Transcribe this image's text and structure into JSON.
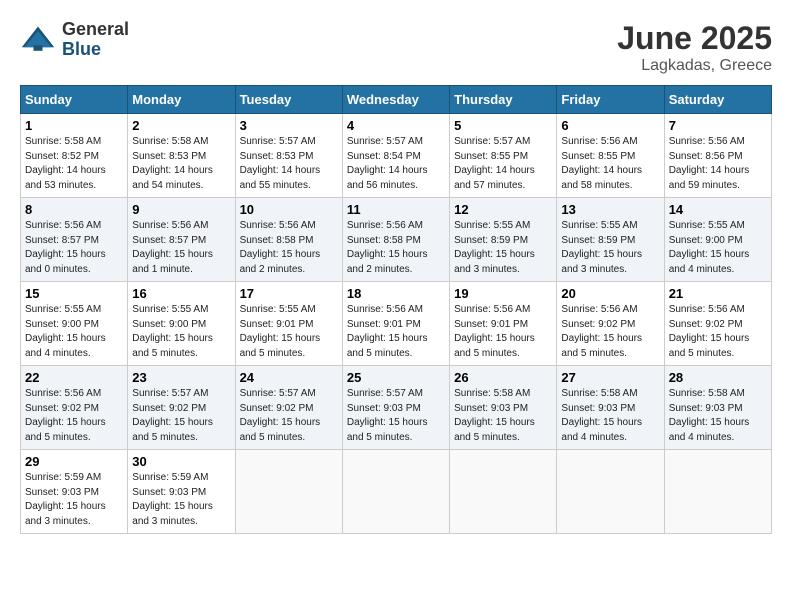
{
  "logo": {
    "general": "General",
    "blue": "Blue"
  },
  "title": {
    "month": "June 2025",
    "location": "Lagkadas, Greece"
  },
  "headers": [
    "Sunday",
    "Monday",
    "Tuesday",
    "Wednesday",
    "Thursday",
    "Friday",
    "Saturday"
  ],
  "weeks": [
    [
      {
        "day": "1",
        "info": "Sunrise: 5:58 AM\nSunset: 8:52 PM\nDaylight: 14 hours\nand 53 minutes."
      },
      {
        "day": "2",
        "info": "Sunrise: 5:58 AM\nSunset: 8:53 PM\nDaylight: 14 hours\nand 54 minutes."
      },
      {
        "day": "3",
        "info": "Sunrise: 5:57 AM\nSunset: 8:53 PM\nDaylight: 14 hours\nand 55 minutes."
      },
      {
        "day": "4",
        "info": "Sunrise: 5:57 AM\nSunset: 8:54 PM\nDaylight: 14 hours\nand 56 minutes."
      },
      {
        "day": "5",
        "info": "Sunrise: 5:57 AM\nSunset: 8:55 PM\nDaylight: 14 hours\nand 57 minutes."
      },
      {
        "day": "6",
        "info": "Sunrise: 5:56 AM\nSunset: 8:55 PM\nDaylight: 14 hours\nand 58 minutes."
      },
      {
        "day": "7",
        "info": "Sunrise: 5:56 AM\nSunset: 8:56 PM\nDaylight: 14 hours\nand 59 minutes."
      }
    ],
    [
      {
        "day": "8",
        "info": "Sunrise: 5:56 AM\nSunset: 8:57 PM\nDaylight: 15 hours\nand 0 minutes."
      },
      {
        "day": "9",
        "info": "Sunrise: 5:56 AM\nSunset: 8:57 PM\nDaylight: 15 hours\nand 1 minute."
      },
      {
        "day": "10",
        "info": "Sunrise: 5:56 AM\nSunset: 8:58 PM\nDaylight: 15 hours\nand 2 minutes."
      },
      {
        "day": "11",
        "info": "Sunrise: 5:56 AM\nSunset: 8:58 PM\nDaylight: 15 hours\nand 2 minutes."
      },
      {
        "day": "12",
        "info": "Sunrise: 5:55 AM\nSunset: 8:59 PM\nDaylight: 15 hours\nand 3 minutes."
      },
      {
        "day": "13",
        "info": "Sunrise: 5:55 AM\nSunset: 8:59 PM\nDaylight: 15 hours\nand 3 minutes."
      },
      {
        "day": "14",
        "info": "Sunrise: 5:55 AM\nSunset: 9:00 PM\nDaylight: 15 hours\nand 4 minutes."
      }
    ],
    [
      {
        "day": "15",
        "info": "Sunrise: 5:55 AM\nSunset: 9:00 PM\nDaylight: 15 hours\nand 4 minutes."
      },
      {
        "day": "16",
        "info": "Sunrise: 5:55 AM\nSunset: 9:00 PM\nDaylight: 15 hours\nand 5 minutes."
      },
      {
        "day": "17",
        "info": "Sunrise: 5:55 AM\nSunset: 9:01 PM\nDaylight: 15 hours\nand 5 minutes."
      },
      {
        "day": "18",
        "info": "Sunrise: 5:56 AM\nSunset: 9:01 PM\nDaylight: 15 hours\nand 5 minutes."
      },
      {
        "day": "19",
        "info": "Sunrise: 5:56 AM\nSunset: 9:01 PM\nDaylight: 15 hours\nand 5 minutes."
      },
      {
        "day": "20",
        "info": "Sunrise: 5:56 AM\nSunset: 9:02 PM\nDaylight: 15 hours\nand 5 minutes."
      },
      {
        "day": "21",
        "info": "Sunrise: 5:56 AM\nSunset: 9:02 PM\nDaylight: 15 hours\nand 5 minutes."
      }
    ],
    [
      {
        "day": "22",
        "info": "Sunrise: 5:56 AM\nSunset: 9:02 PM\nDaylight: 15 hours\nand 5 minutes."
      },
      {
        "day": "23",
        "info": "Sunrise: 5:57 AM\nSunset: 9:02 PM\nDaylight: 15 hours\nand 5 minutes."
      },
      {
        "day": "24",
        "info": "Sunrise: 5:57 AM\nSunset: 9:02 PM\nDaylight: 15 hours\nand 5 minutes."
      },
      {
        "day": "25",
        "info": "Sunrise: 5:57 AM\nSunset: 9:03 PM\nDaylight: 15 hours\nand 5 minutes."
      },
      {
        "day": "26",
        "info": "Sunrise: 5:58 AM\nSunset: 9:03 PM\nDaylight: 15 hours\nand 5 minutes."
      },
      {
        "day": "27",
        "info": "Sunrise: 5:58 AM\nSunset: 9:03 PM\nDaylight: 15 hours\nand 4 minutes."
      },
      {
        "day": "28",
        "info": "Sunrise: 5:58 AM\nSunset: 9:03 PM\nDaylight: 15 hours\nand 4 minutes."
      }
    ],
    [
      {
        "day": "29",
        "info": "Sunrise: 5:59 AM\nSunset: 9:03 PM\nDaylight: 15 hours\nand 3 minutes."
      },
      {
        "day": "30",
        "info": "Sunrise: 5:59 AM\nSunset: 9:03 PM\nDaylight: 15 hours\nand 3 minutes."
      },
      {
        "day": "",
        "info": ""
      },
      {
        "day": "",
        "info": ""
      },
      {
        "day": "",
        "info": ""
      },
      {
        "day": "",
        "info": ""
      },
      {
        "day": "",
        "info": ""
      }
    ]
  ]
}
